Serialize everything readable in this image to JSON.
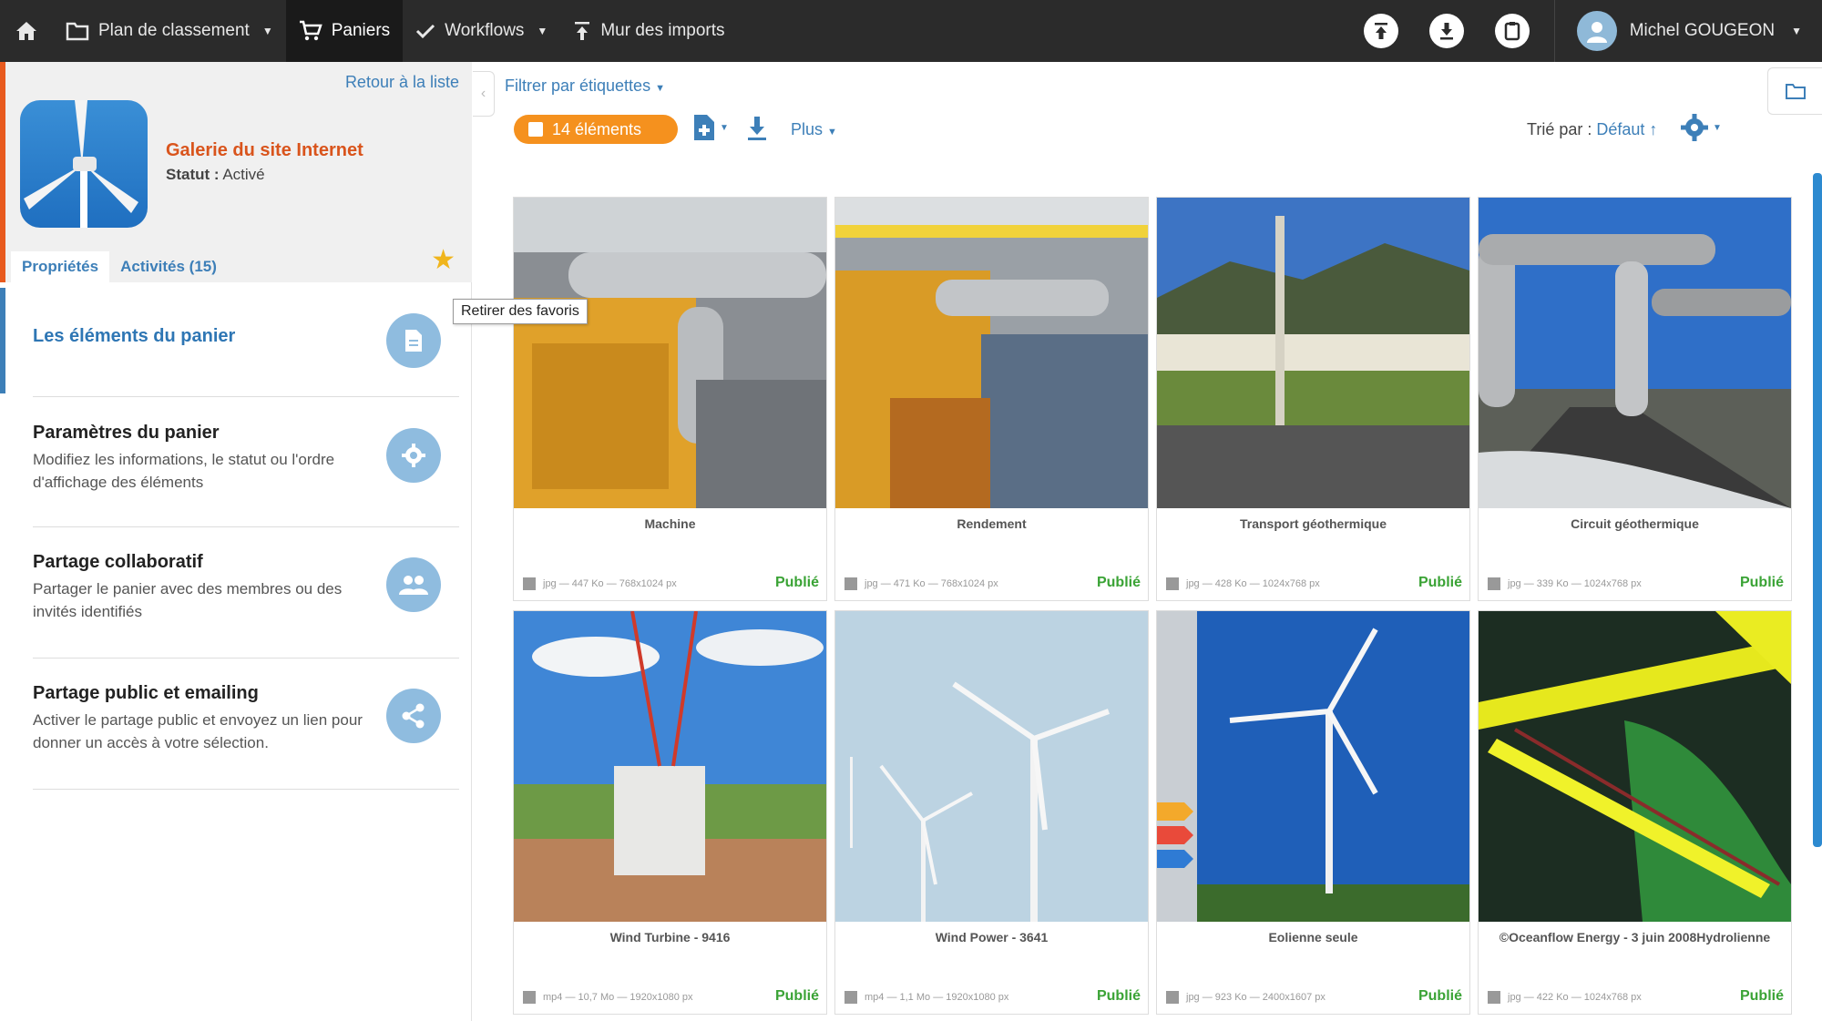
{
  "nav": {
    "classement": "Plan de classement",
    "paniers": "Paniers",
    "workflows": "Workflows",
    "imports": "Mur des imports",
    "user_name": "Michel GOUGEON"
  },
  "basket": {
    "back": "Retour à la liste",
    "title": "Galerie du site Internet",
    "status_label": "Statut :",
    "status_value": "Activé",
    "tab_props": "Propriétés",
    "tab_activities": "Activités (15)",
    "tooltip": "Retirer des favoris"
  },
  "menu": [
    {
      "title": "Les éléments du panier",
      "desc": ""
    },
    {
      "title": "Paramètres du panier",
      "desc": "Modifiez les informations, le statut ou l'ordre d'affichage des éléments"
    },
    {
      "title": "Partage collaboratif",
      "desc": "Partager le panier avec des membres ou des invités identifiés"
    },
    {
      "title": "Partage public et emailing",
      "desc": "Activer le partage public et envoyez un lien pour donner un accès à votre sélection."
    }
  ],
  "toolbar": {
    "filter": "Filtrer par étiquettes",
    "count": "14 éléments",
    "more": "Plus",
    "sort_label": "Trié par :",
    "sort_value": "Défaut ↑"
  },
  "items": [
    {
      "title": "Machine",
      "meta": "jpg — 447 Ko — 768x1024 px",
      "status": "Publié"
    },
    {
      "title": "Rendement",
      "meta": "jpg — 471 Ko — 768x1024 px",
      "status": "Publié"
    },
    {
      "title": "Transport géothermique",
      "meta": "jpg — 428 Ko — 1024x768 px",
      "status": "Publié"
    },
    {
      "title": "Circuit géothermique",
      "meta": "jpg — 339 Ko — 1024x768 px",
      "status": "Publié"
    },
    {
      "title": "Wind Turbine - 9416",
      "meta": "mp4 — 10,7 Mo — 1920x1080 px",
      "status": "Publié"
    },
    {
      "title": "Wind Power - 3641",
      "meta": "mp4 — 1,1 Mo — 1920x1080 px",
      "status": "Publié"
    },
    {
      "title": "Eolienne seule",
      "meta": "jpg — 923 Ko — 2400x1607 px",
      "status": "Publié"
    },
    {
      "title": "©Oceanflow Energy - 3 juin 2008Hydrolienne",
      "meta": "jpg — 422 Ko — 1024x768 px",
      "status": "Publié"
    }
  ]
}
